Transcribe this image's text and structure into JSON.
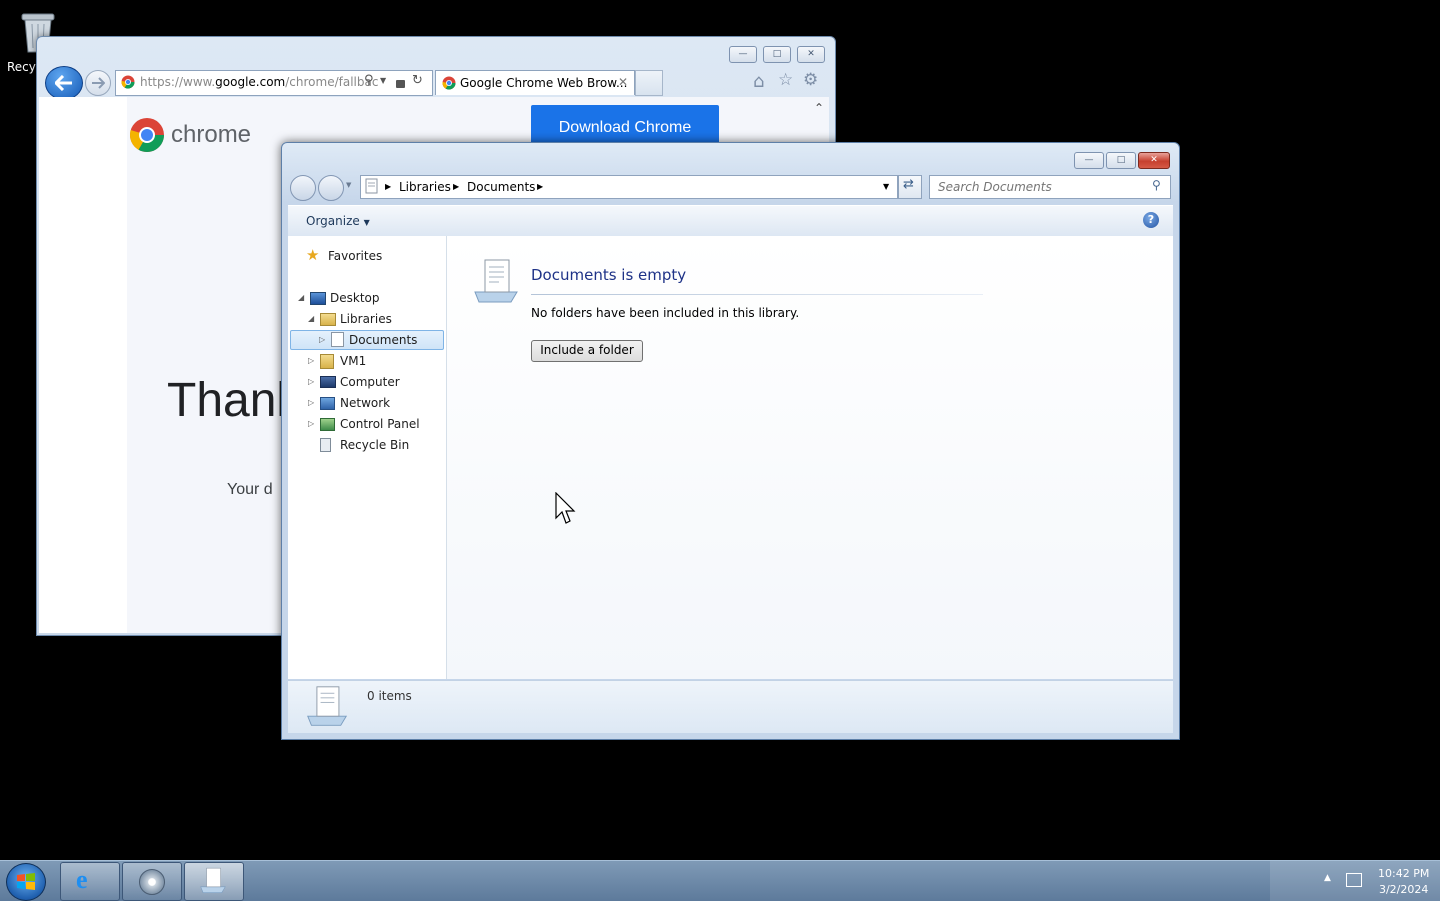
{
  "desktop": {
    "recycle_bin_label": "Recyc"
  },
  "ie_window": {
    "address_url_prefix": "https://www.",
    "address_url_domain": "google.com",
    "address_url_path": "/chrome/fallbac",
    "tab_title": "Google Chrome Web Brow...",
    "page": {
      "logo_text": "chrome",
      "download_button": "Download Chrome",
      "heading_partial": "Thank",
      "body_partial": "Your d"
    }
  },
  "explorer": {
    "breadcrumb": [
      "Libraries",
      "Documents"
    ],
    "search_placeholder": "Search Documents",
    "organize_label": "Organize",
    "nav_tree": {
      "favorites": "Favorites",
      "desktop": "Desktop",
      "libraries": "Libraries",
      "documents": "Documents",
      "vm1": "VM1",
      "computer": "Computer",
      "network": "Network",
      "control_panel": "Control Panel",
      "recycle_bin": "Recycle Bin"
    },
    "main": {
      "empty_title": "Documents is empty",
      "empty_message": "No folders have been included in this library.",
      "include_button": "Include a folder"
    },
    "details": {
      "item_count": "0 items"
    }
  },
  "taskbar": {
    "clock_time": "10:42 PM",
    "clock_date": "3/2/2024"
  },
  "colors": {
    "chrome_blue": "#1a73e8",
    "explorer_title_text": "#1e3287",
    "taskbar": "#6a87a6"
  }
}
